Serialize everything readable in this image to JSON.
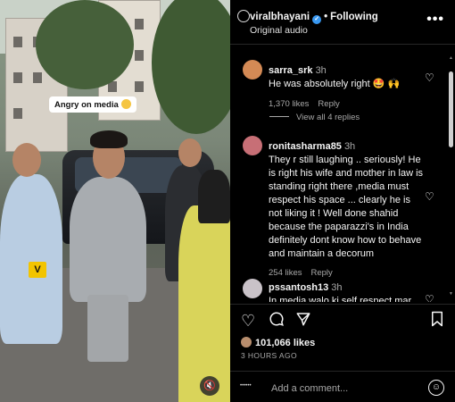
{
  "media": {
    "caption_tag": "Angry on media",
    "watermark_letter": "V",
    "mute_icon": "speaker-muted-icon"
  },
  "header": {
    "username": "viralbhayani",
    "separator": "•",
    "follow_label": "Following",
    "audio_label": "Original audio",
    "more_icon": "more-options-icon"
  },
  "comments": [
    {
      "user": "sarra_srk",
      "time": "3h",
      "text": "He was absolutely right 🤩 🙌",
      "likes": "1,370 likes",
      "reply": "Reply",
      "avatar_color": "#d48a55"
    },
    {
      "user": "ronitasharma85",
      "time": "3h",
      "text": "They r still laughing .. seriously! He is right his wife and mother in law is standing right there ,media must respect his space ... clearly he is not liking it ! Well done shahid because the paparazzi's in India definitely dont know how to behave and maintain a decorum",
      "likes": "254 likes",
      "reply": "Reply",
      "avatar_color": "#c76f76"
    },
    {
      "user": "pssantosh13",
      "time": "3h",
      "text": "In media walo ki self respect mar",
      "avatar_color": "#c9c2c8"
    }
  ],
  "view_replies": "View all 4 replies",
  "actions": {
    "like_icon": "heart-icon",
    "comment_icon": "comment-icon",
    "share_icon": "send-icon",
    "save_icon": "bookmark-icon"
  },
  "likes_count": "101,066 likes",
  "posted_time": "3 HOURS AGO",
  "add_comment": {
    "placeholder": "Add a comment...",
    "emoji_icon": "emoji-icon"
  }
}
